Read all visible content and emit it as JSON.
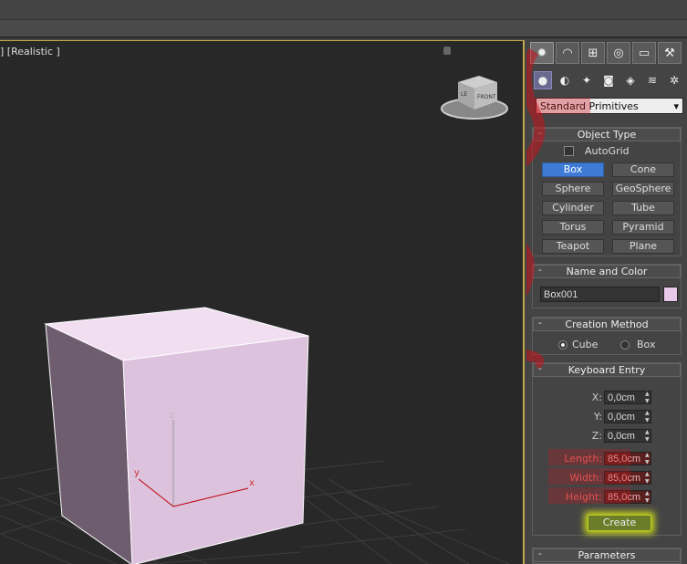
{
  "viewport": {
    "label": "] [Realistic ]",
    "viewcube_face": "FRONT",
    "viewcube_side": "LE"
  },
  "axes": {
    "x": "x",
    "y": "y",
    "z": "z"
  },
  "command_panel": {
    "tabs": [
      "create",
      "modify",
      "hierarchy",
      "motion",
      "display",
      "utilities"
    ],
    "category": "Standard Primitives",
    "object_type": {
      "title": "Object Type",
      "autogrid": "AutoGrid",
      "buttons": [
        "Box",
        "Cone",
        "Sphere",
        "GeoSphere",
        "Cylinder",
        "Tube",
        "Torus",
        "Pyramid",
        "Teapot",
        "Plane"
      ]
    },
    "name_color": {
      "title": "Name and Color",
      "name": "Box001",
      "color": "#e8c9ea"
    },
    "creation_method": {
      "title": "Creation Method",
      "options": [
        "Cube",
        "Box"
      ],
      "selected": "Cube"
    },
    "keyboard_entry": {
      "title": "Keyboard Entry",
      "fields": [
        {
          "label": "X:",
          "value": "0,0cm"
        },
        {
          "label": "Y:",
          "value": "0,0cm"
        },
        {
          "label": "Z:",
          "value": "0,0cm"
        },
        {
          "label": "Length:",
          "value": "85,0cm"
        },
        {
          "label": "Width:",
          "value": "85,0cm"
        },
        {
          "label": "Height:",
          "value": "85,0cm"
        }
      ],
      "create_label": "Create"
    },
    "parameters": {
      "title": "Parameters"
    }
  },
  "colors": {
    "highlight_red": "#c8141e",
    "highlight_yellow": "#cfe01c",
    "selected_blue": "#3d7bd6",
    "viewport_border": "#bfa94a"
  }
}
